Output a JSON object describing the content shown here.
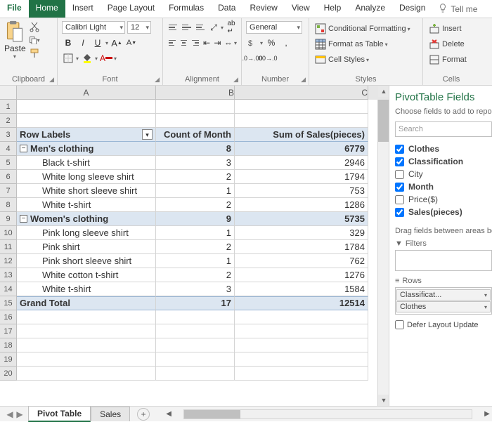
{
  "menu": {
    "items": [
      "File",
      "Home",
      "Insert",
      "Page Layout",
      "Formulas",
      "Data",
      "Review",
      "View",
      "Help",
      "Analyze",
      "Design"
    ],
    "active": 1,
    "tellme": "Tell me"
  },
  "ribbon": {
    "clipboard": {
      "paste": "Paste",
      "label": "Clipboard"
    },
    "font": {
      "family": "Calibri Light",
      "size": "12",
      "label": "Font"
    },
    "alignment": {
      "label": "Alignment"
    },
    "number": {
      "format": "General",
      "label": "Number"
    },
    "styles": {
      "cond": "Conditional Formatting",
      "table": "Format as Table",
      "cell": "Cell Styles",
      "label": "Styles"
    },
    "cells": {
      "insert": "Insert",
      "delete": "Delete",
      "format": "Format",
      "label": "Cells"
    }
  },
  "grid": {
    "cols": [
      "A",
      "B",
      "C"
    ],
    "headerRow": {
      "a": "Row Labels",
      "b": "Count of Month",
      "c": "Sum of Sales(pieces)"
    },
    "group1": {
      "a": "Men's clothing",
      "b": "8",
      "c": "6779"
    },
    "rows1": [
      {
        "a": "Black t-shirt",
        "b": "3",
        "c": "2946"
      },
      {
        "a": "White long sleeve shirt",
        "b": "2",
        "c": "1794"
      },
      {
        "a": "White short sleeve shirt",
        "b": "1",
        "c": "753"
      },
      {
        "a": "White t-shirt",
        "b": "2",
        "c": "1286"
      }
    ],
    "group2": {
      "a": "Women's clothing",
      "b": "9",
      "c": "5735"
    },
    "rows2": [
      {
        "a": "Pink long sleeve shirt",
        "b": "1",
        "c": "329"
      },
      {
        "a": "Pink shirt",
        "b": "2",
        "c": "1784"
      },
      {
        "a": "Pink short sleeve shirt",
        "b": "1",
        "c": "762"
      },
      {
        "a": "White cotton t-shirt",
        "b": "2",
        "c": "1276"
      },
      {
        "a": "White t-shirt",
        "b": "3",
        "c": "1584"
      }
    ],
    "grand": {
      "a": "Grand Total",
      "b": "17",
      "c": "12514"
    }
  },
  "pane": {
    "title": "PivotTable Fields",
    "hint": "Choose fields to add to report:",
    "search": "Search",
    "fields": [
      {
        "name": "Clothes",
        "checked": true
      },
      {
        "name": "Classification",
        "checked": true
      },
      {
        "name": "City",
        "checked": false
      },
      {
        "name": "Month",
        "checked": true
      },
      {
        "name": "Price($)",
        "checked": false
      },
      {
        "name": "Sales(pieces)",
        "checked": true
      }
    ],
    "dragHint": "Drag fields between areas below:",
    "zones": {
      "filters": "Filters",
      "rows": "Rows",
      "rowItems": [
        "Classificat...",
        "Clothes"
      ]
    },
    "defer": "Defer Layout Update"
  },
  "tabs": {
    "sheets": [
      "Pivot Table",
      "Sales"
    ],
    "active": 0
  },
  "chart_data": {
    "type": "table",
    "title": "Pivot Table",
    "columns": [
      "Row Labels",
      "Count of Month",
      "Sum of Sales(pieces)"
    ],
    "data": [
      {
        "group": "Men's clothing",
        "count": 8,
        "sum": 6779,
        "children": [
          {
            "label": "Black t-shirt",
            "count": 3,
            "sum": 2946
          },
          {
            "label": "White long sleeve shirt",
            "count": 2,
            "sum": 1794
          },
          {
            "label": "White short sleeve shirt",
            "count": 1,
            "sum": 753
          },
          {
            "label": "White t-shirt",
            "count": 2,
            "sum": 1286
          }
        ]
      },
      {
        "group": "Women's clothing",
        "count": 9,
        "sum": 5735,
        "children": [
          {
            "label": "Pink long sleeve shirt",
            "count": 1,
            "sum": 329
          },
          {
            "label": "Pink shirt",
            "count": 2,
            "sum": 1784
          },
          {
            "label": "Pink short sleeve shirt",
            "count": 1,
            "sum": 762
          },
          {
            "label": "White cotton t-shirt",
            "count": 2,
            "sum": 1276
          },
          {
            "label": "White t-shirt",
            "count": 3,
            "sum": 1584
          }
        ]
      }
    ],
    "grand_total": {
      "count": 17,
      "sum": 12514
    }
  }
}
